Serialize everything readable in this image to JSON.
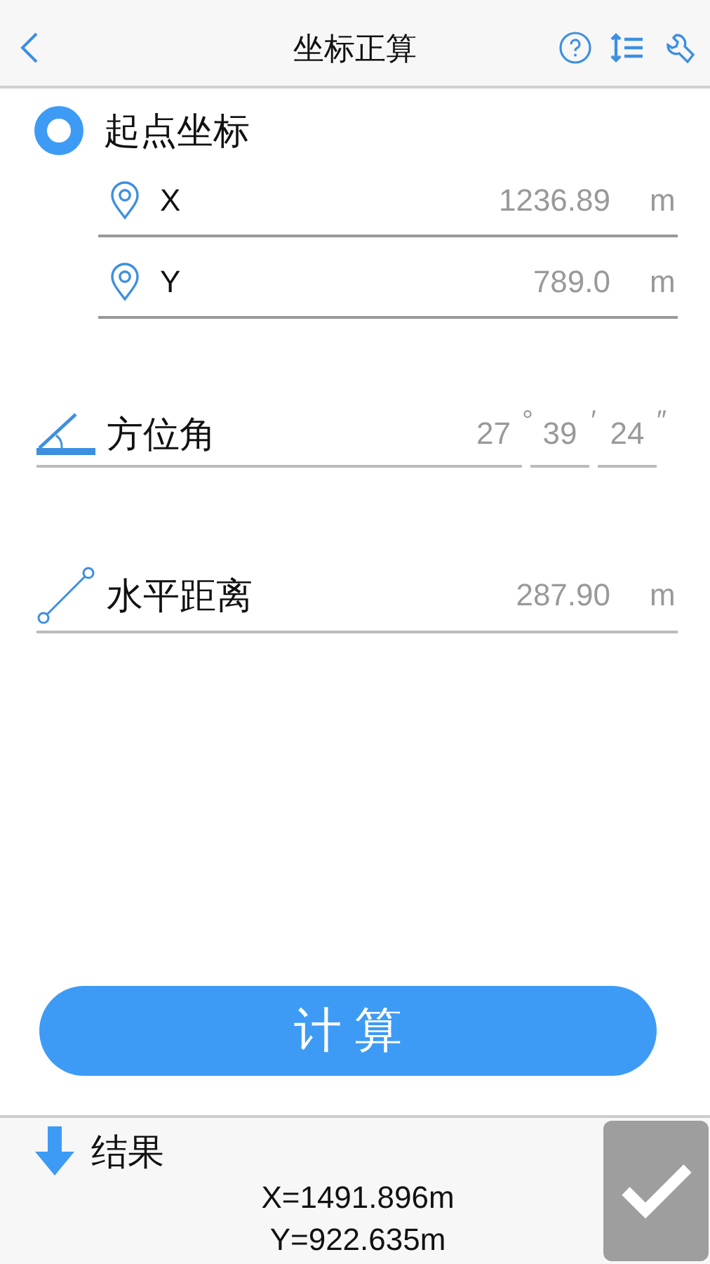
{
  "header": {
    "title": "坐标正算"
  },
  "start_point": {
    "title": "起点坐标",
    "fields": [
      {
        "label": "X",
        "value": "1236.89",
        "unit": "m"
      },
      {
        "label": "Y",
        "value": "789.0",
        "unit": "m"
      }
    ]
  },
  "azimuth": {
    "label": "方位角",
    "parts": [
      {
        "value": "27",
        "unit": "°"
      },
      {
        "value": "39",
        "unit": "′"
      },
      {
        "value": "24",
        "unit": "″"
      }
    ]
  },
  "distance": {
    "label": "水平距离",
    "value": "287.90",
    "unit": "m"
  },
  "calculate_button": "计 算",
  "result": {
    "title": "结果",
    "lines": [
      "X=1491.896m",
      "Y=922.635m"
    ]
  }
}
